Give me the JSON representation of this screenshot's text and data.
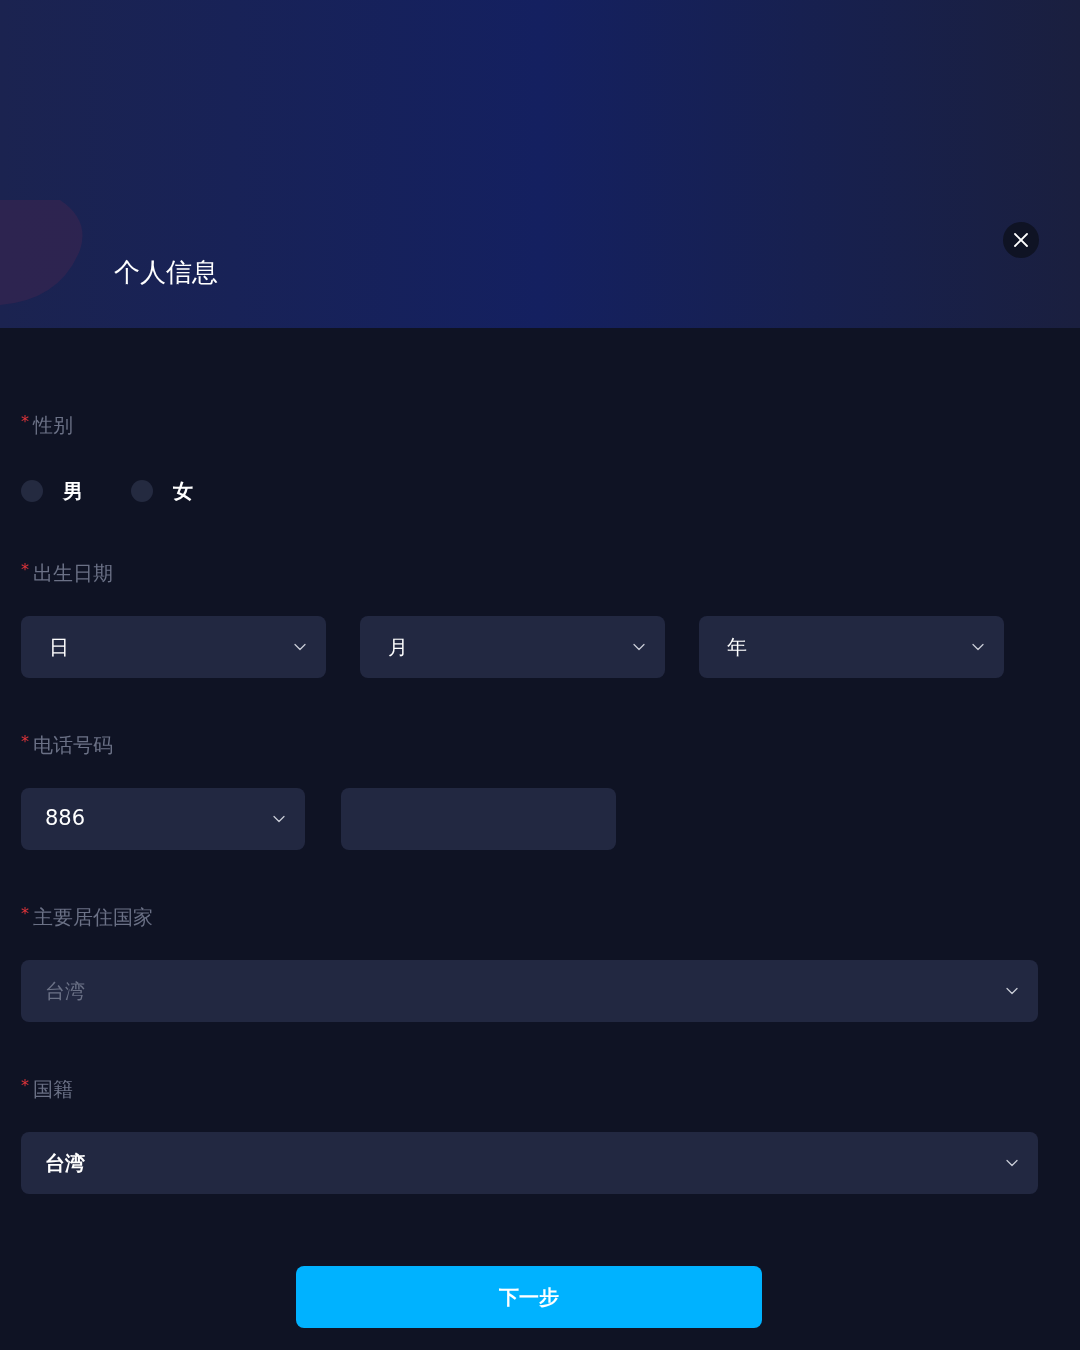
{
  "header": {
    "title": "个人信息"
  },
  "fields": [
    {
      "kind": "radio",
      "mark": "*",
      "label": "性别",
      "options": [
        {
          "label": "男",
          "selected": false
        },
        {
          "label": "女",
          "selected": false
        }
      ]
    },
    {
      "kind": "date",
      "mark": "*",
      "label": "出生日期",
      "selects": [
        {
          "placeholder": "日"
        },
        {
          "placeholder": "月"
        },
        {
          "placeholder": "年"
        }
      ]
    },
    {
      "kind": "phone",
      "mark": "*",
      "label": "电话号码",
      "code": "886"
    },
    {
      "kind": "select",
      "mark": "*",
      "label": "主要居住国家",
      "value": "台湾",
      "disabled": true
    },
    {
      "kind": "select",
      "mark": "*",
      "label": "国籍",
      "value": "台湾",
      "disabled": false
    }
  ],
  "submit": "下一步"
}
